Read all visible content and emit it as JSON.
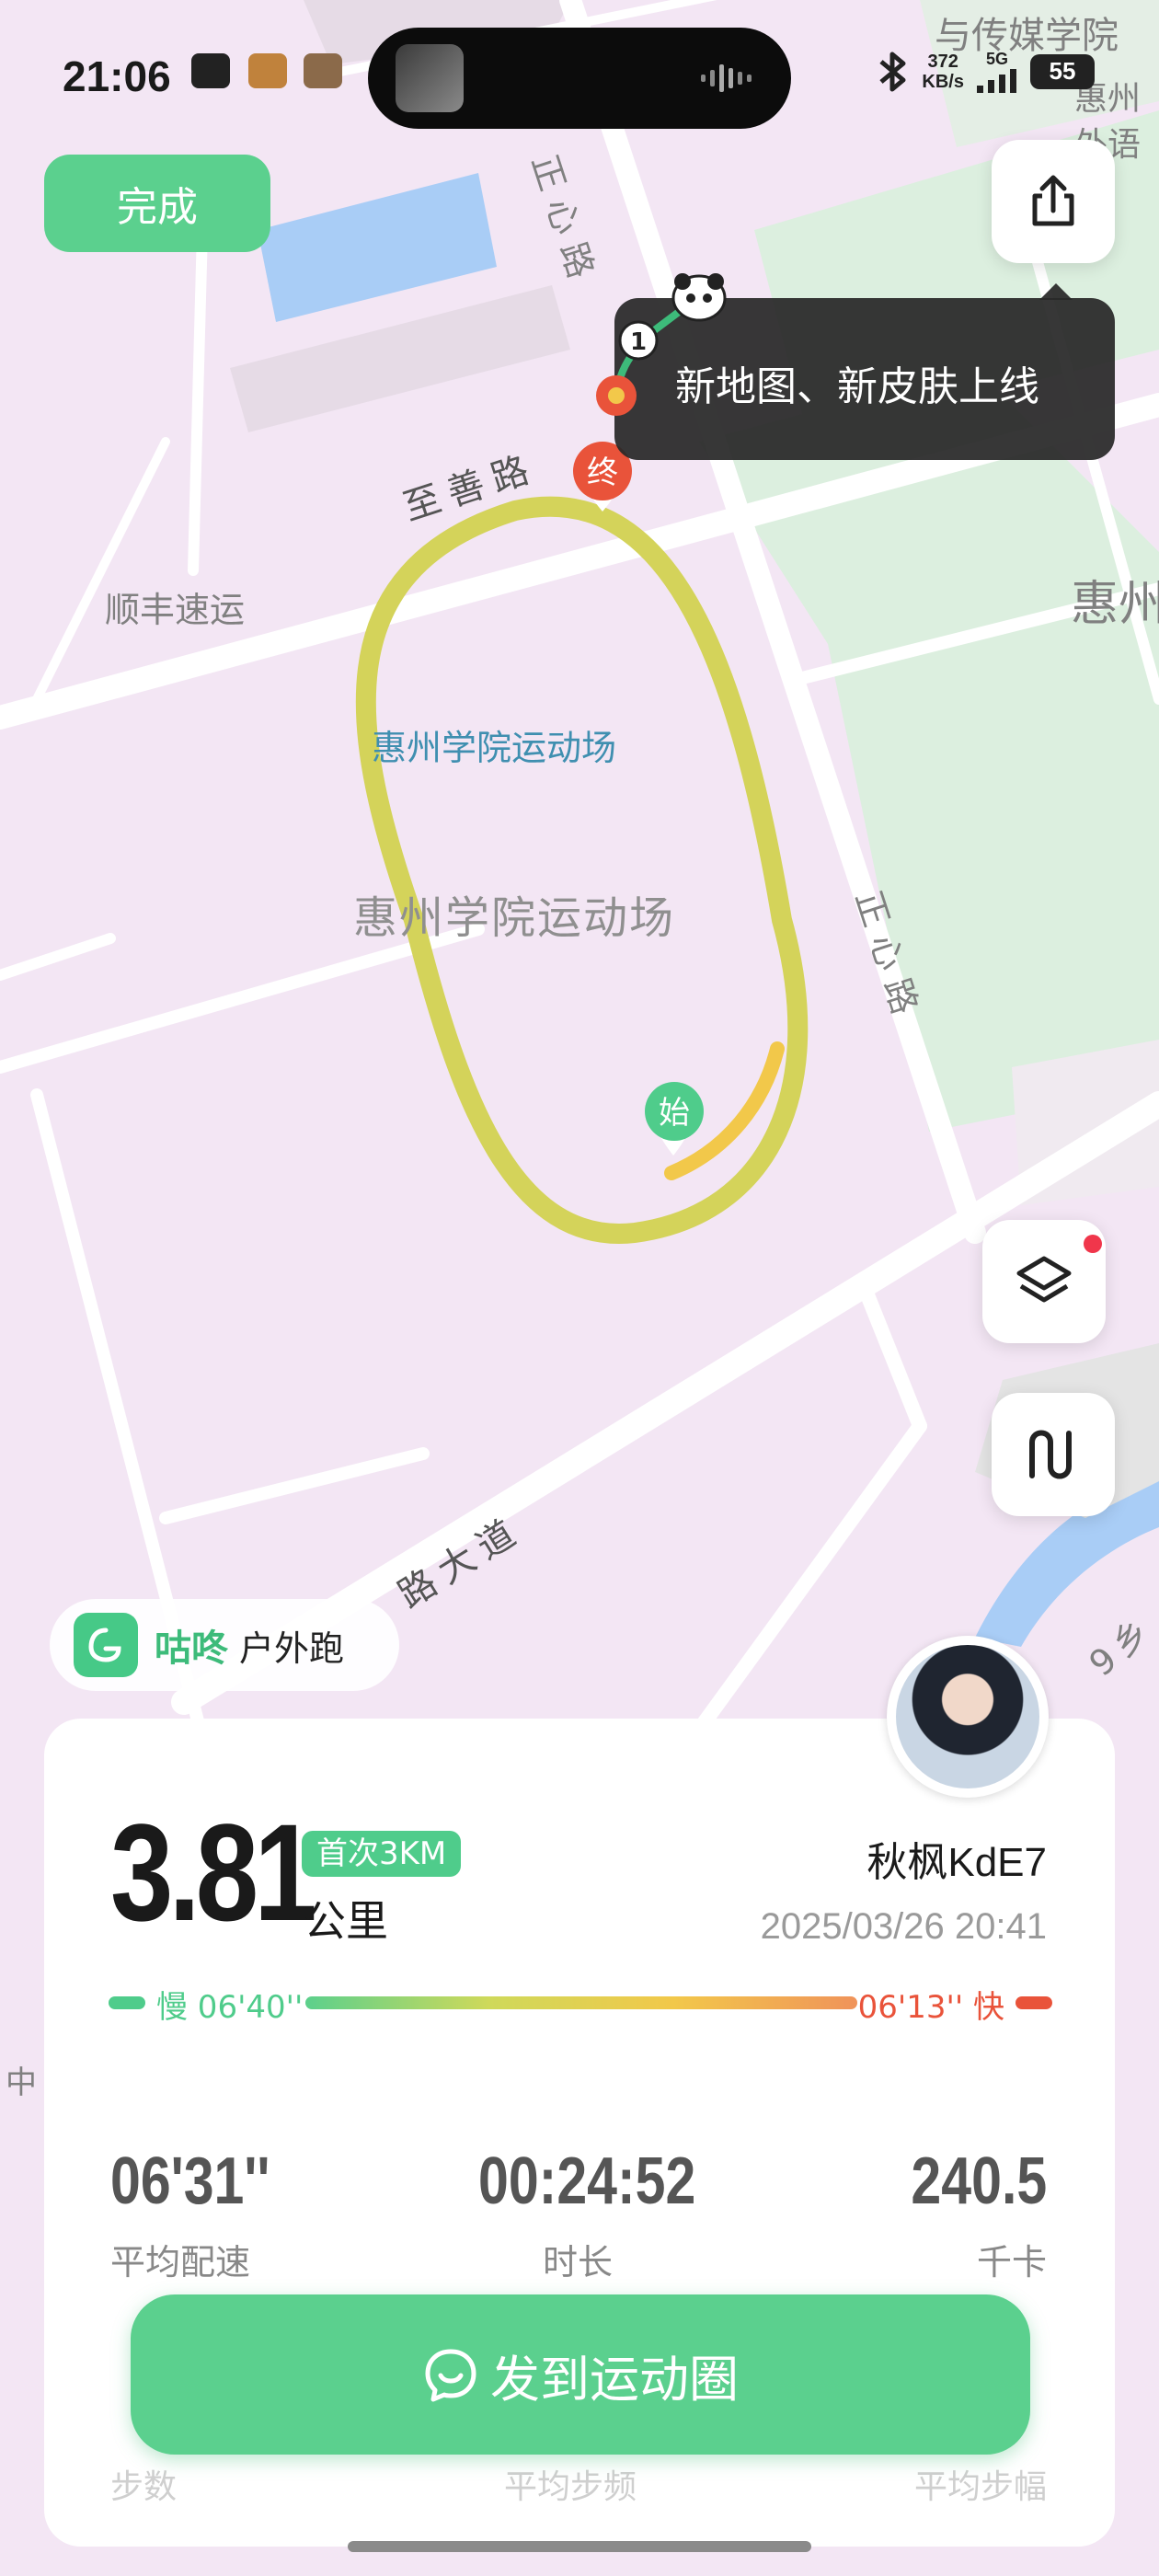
{
  "status_bar": {
    "time": "21:06",
    "net_speed_value": "372",
    "net_speed_unit": "KB/s",
    "network": "5G",
    "battery": "55"
  },
  "map": {
    "labels": {
      "media_college": "与传媒学院",
      "foreign_lang": "外语",
      "huizhou_right": "惠州",
      "huizhou_right2": "惠州",
      "zhengxin_road_top": "正心路",
      "zhengxin_road_mid": "正心路",
      "zhishan_road": "至善路",
      "sf_express": "顺丰速运",
      "stadium_blue": "惠州学院运动场",
      "stadium_grey": "惠州学院运动场",
      "avenue": "路大道",
      "right_bottom": "9乡",
      "left_char": "中"
    },
    "start_marker": "始",
    "end_marker": "终",
    "track_color": "#d4d35a"
  },
  "header": {
    "done_label": "完成"
  },
  "tooltip": {
    "text": "新地图、新皮肤上线",
    "step_badge": "1"
  },
  "app_tag": {
    "brand": "咕咚",
    "activity": "户外跑"
  },
  "summary": {
    "distance": "3.81",
    "badge": "首次3KM",
    "unit": "公里",
    "username": "秋枫KdE7",
    "datetime": "2025/03/26 20:41",
    "pace_slow": "慢 06'40''",
    "pace_fast": "06'13'' 快"
  },
  "stats": [
    {
      "value": "06'31''",
      "label": "平均配速"
    },
    {
      "value": "00:24:52",
      "label": "时长"
    },
    {
      "value": "240.5",
      "label": "千卡"
    }
  ],
  "faded_row": {
    "left": "步数",
    "mid": "平均步频",
    "right": "平均步幅"
  },
  "post_button": {
    "label": "发到运动圈"
  },
  "colors": {
    "accent_green": "#5bd08e",
    "fast_red": "#e9533a",
    "track": "#d4d35a"
  }
}
